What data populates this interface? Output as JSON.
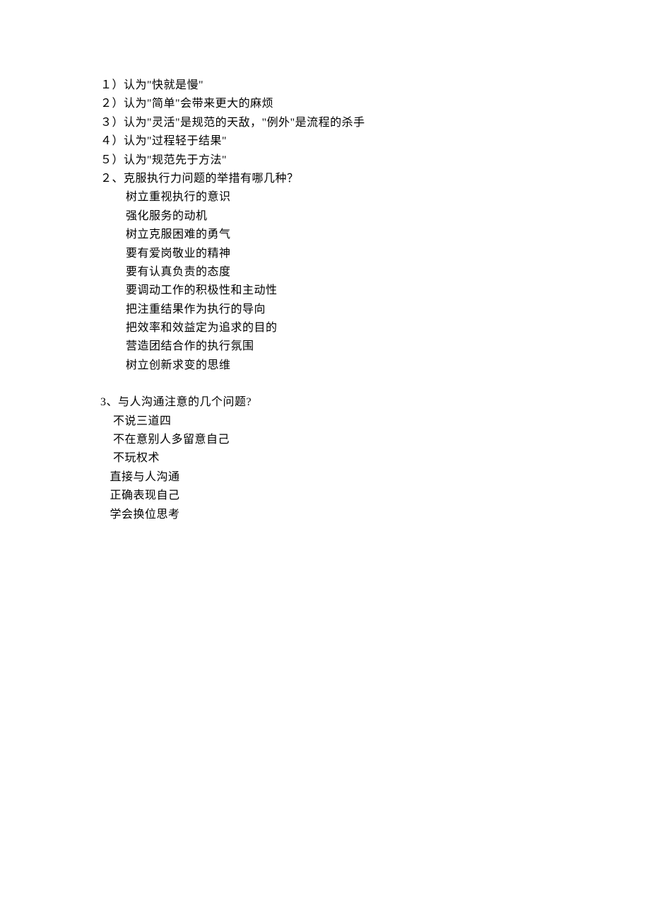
{
  "section1": {
    "items": [
      "１）认为\"快就是慢\"",
      "２）认为\"简单\"会带来更大的麻烦",
      "３）认为\"灵活\"是规范的天敌，\"例外\"是流程的杀手",
      "４）认为\"过程轻于结果\"",
      "５）认为\"规范先于方法\""
    ]
  },
  "section2": {
    "question": "２、克服执行力问题的举措有哪几种？",
    "answers": [
      "        树立重视执行的意识",
      "        强化服务的动机",
      "        树立克服困难的勇气",
      "        要有爱岗敬业的精神",
      "        要有认真负责的态度",
      "        要调动工作的积极性和主动性",
      "        把注重结果作为执行的导向",
      "        把效率和效益定为追求的目的",
      "        营造团结合作的执行氛围",
      "        树立创新求变的思维"
    ]
  },
  "section3": {
    "question": "3、与人沟通注意的几个问题?",
    "answers": [
      "    不说三道四",
      "    不在意别人多留意自己",
      "    不玩权术",
      "   直接与人沟通",
      "   正确表现自己",
      "   学会换位思考"
    ]
  }
}
